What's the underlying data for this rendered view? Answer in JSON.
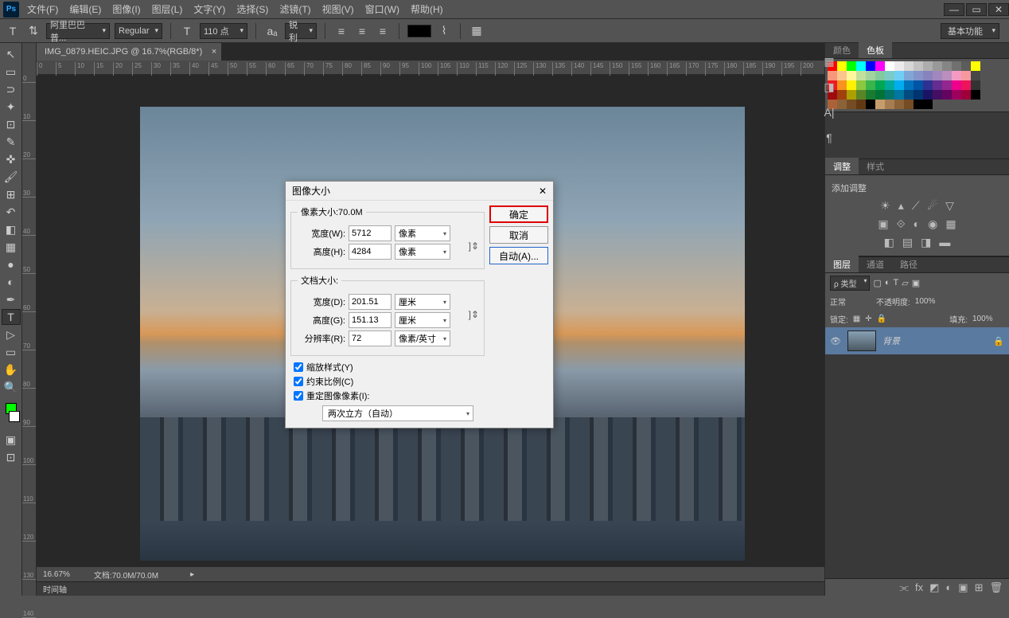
{
  "menu": {
    "file": "文件(F)",
    "edit": "编辑(E)",
    "image": "图像(I)",
    "layer": "图层(L)",
    "type": "文字(Y)",
    "select": "选择(S)",
    "filter": "滤镜(T)",
    "view": "视图(V)",
    "window": "窗口(W)",
    "help": "帮助(H)"
  },
  "optbar": {
    "font_family": "阿里巴巴普...",
    "font_style": "Regular",
    "font_size": "110 点",
    "workspace": "基本功能"
  },
  "doc": {
    "tab": "IMG_0879.HEIC.JPG @ 16.7%(RGB/8*)",
    "zoom": "16.67%",
    "info": "文档:70.0M/70.0M",
    "timeline": "时间轴"
  },
  "right": {
    "color_tab": "颜色",
    "swatch_tab": "色板",
    "adjust_tab": "调整",
    "style_tab": "样式",
    "adjust_label": "添加调整",
    "layers_tab": "图层",
    "channels_tab": "通道",
    "paths_tab": "路径",
    "kind": "ρ 类型",
    "blend": "正常",
    "opacity_label": "不透明度:",
    "opacity_val": "100%",
    "lock_label": "锁定:",
    "fill_label": "填充:",
    "fill_val": "100%",
    "layer_name": "背景"
  },
  "dialog": {
    "title": "图像大小",
    "pixel_legend": "像素大小:70.0M",
    "width_px_label": "宽度(W):",
    "width_px": "5712",
    "px_unit": "像素",
    "height_px_label": "高度(H):",
    "height_px": "4284",
    "doc_legend": "文档大小:",
    "width_cm_label": "宽度(D):",
    "width_cm": "201.51",
    "cm_unit": "厘米",
    "height_cm_label": "高度(G):",
    "height_cm": "151.13",
    "res_label": "分辨率(R):",
    "res": "72",
    "res_unit": "像素/英寸",
    "scale_styles": "缩放样式(Y)",
    "constrain": "约束比例(C)",
    "resample": "重定图像像素(I):",
    "resample_method": "两次立方（自动）",
    "ok": "确定",
    "cancel": "取消",
    "auto": "自动(A)..."
  },
  "swatch_colors": [
    "#ff0000",
    "#ffff00",
    "#00ff00",
    "#00ffff",
    "#0000ff",
    "#ff00ff",
    "#ffffff",
    "#ebebeb",
    "#d6d6d6",
    "#c2c2c2",
    "#adadad",
    "#999999",
    "#858585",
    "#707070",
    "#5c5c5c",
    "#ffff00",
    "#f7977a",
    "#fbc58e",
    "#fff799",
    "#c4df9b",
    "#a2d39c",
    "#82ca9d",
    "#7accc8",
    "#6ecff6",
    "#7ea7d8",
    "#8493ca",
    "#8882be",
    "#a187be",
    "#bc8dbf",
    "#f49ac2",
    "#f6989d",
    "#474747",
    "#ed1c24",
    "#f7941d",
    "#fff200",
    "#8dc73f",
    "#39b54a",
    "#00a651",
    "#00a99d",
    "#00aeef",
    "#0072bc",
    "#0054a6",
    "#2e3192",
    "#662d91",
    "#92278f",
    "#ec008c",
    "#ed145b",
    "#333333",
    "#9e0b0f",
    "#a0410d",
    "#aba000",
    "#598527",
    "#1a7b30",
    "#007236",
    "#00746b",
    "#0076a3",
    "#004b80",
    "#003471",
    "#1b1464",
    "#440e62",
    "#630460",
    "#9e005d",
    "#9e0039",
    "#000000",
    "#ac6239",
    "#8c6239",
    "#754c24",
    "#603913",
    "#000000",
    "#c69c6d",
    "#a67c52",
    "#8c6239",
    "#754c24",
    "#000000",
    "#000000",
    "",
    "",
    "",
    "",
    ""
  ]
}
